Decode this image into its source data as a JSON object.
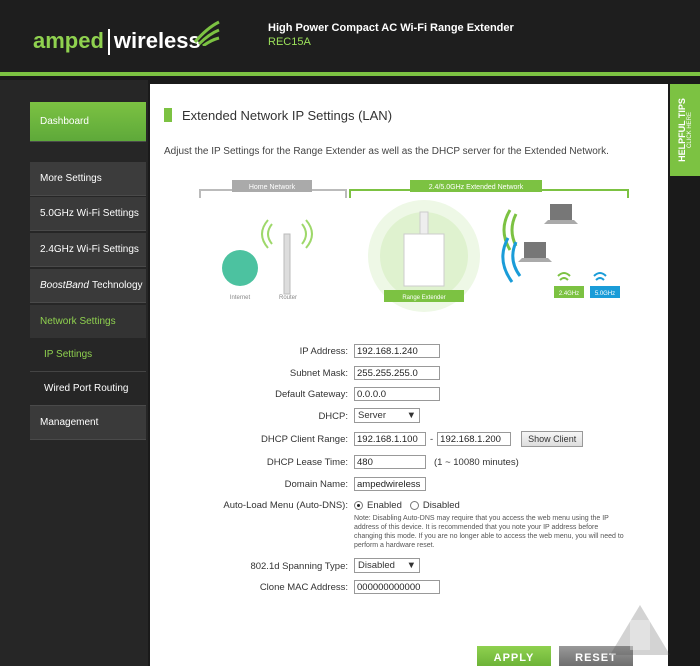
{
  "header": {
    "brand_part1": "amped",
    "brand_part2": "wireless",
    "product_title": "High Power Compact AC Wi-Fi Range Extender",
    "model": "REC15A"
  },
  "sidebar": {
    "items": [
      {
        "label": "Dashboard"
      },
      {
        "label": "More Settings"
      },
      {
        "label": "5.0GHz Wi-Fi Settings"
      },
      {
        "label": "2.4GHz Wi-Fi Settings"
      },
      {
        "label_italic": "BoostBand",
        "label": "Technology"
      },
      {
        "label": "Network Settings"
      },
      {
        "label": "IP Settings"
      },
      {
        "label": "Wired Port Routing"
      },
      {
        "label": "Management"
      }
    ]
  },
  "main": {
    "title": "Extended Network IP Settings (LAN)",
    "description": "Adjust the IP Settings for the Range Extender as well as the DHCP server for the Extended Network.",
    "diagram": {
      "home_network": "Home Network",
      "extended_network": "2.4/5.0GHz Extended Network",
      "internet": "Internet",
      "router": "Router",
      "range_extender": "Range Extender",
      "band_24": "2.4GHz",
      "band_50": "5.0GHz"
    }
  },
  "form": {
    "ip_address_label": "IP Address:",
    "ip_address_value": "192.168.1.240",
    "subnet_label": "Subnet Mask:",
    "subnet_value": "255.255.255.0",
    "gateway_label": "Default Gateway:",
    "gateway_value": "0.0.0.0",
    "dhcp_label": "DHCP:",
    "dhcp_value": "Server",
    "range_label": "DHCP Client Range:",
    "range_start": "192.168.1.100",
    "range_sep": "-",
    "range_end": "192.168.1.200",
    "show_client": "Show Client",
    "lease_label": "DHCP Lease Time:",
    "lease_value": "480",
    "lease_hint": "(1 ~ 10080 minutes)",
    "domain_label": "Domain Name:",
    "domain_value": "ampedwireless",
    "autodns_label": "Auto-Load Menu (Auto-DNS):",
    "autodns_enabled": "Enabled",
    "autodns_disabled": "Disabled",
    "autodns_note": "Note: Disabling Auto-DNS may require that you access the web menu using the IP address of this device. It is recommended that you note your IP address before changing this mode. If you are no longer able to access the web menu, you will need to perform a hardware reset.",
    "spanning_label": "802.1d Spanning Type:",
    "spanning_value": "Disabled",
    "mac_label": "Clone MAC Address:",
    "mac_value": "000000000000"
  },
  "actions": {
    "apply": "APPLY",
    "reset": "RESET"
  },
  "tips": {
    "title": "HELPFUL TIPS",
    "sub": "CLICK HERE"
  },
  "colors": {
    "accent_green": "#7cc242",
    "header_bg": "#1e1e1e",
    "blue": "#1a9cd8"
  }
}
